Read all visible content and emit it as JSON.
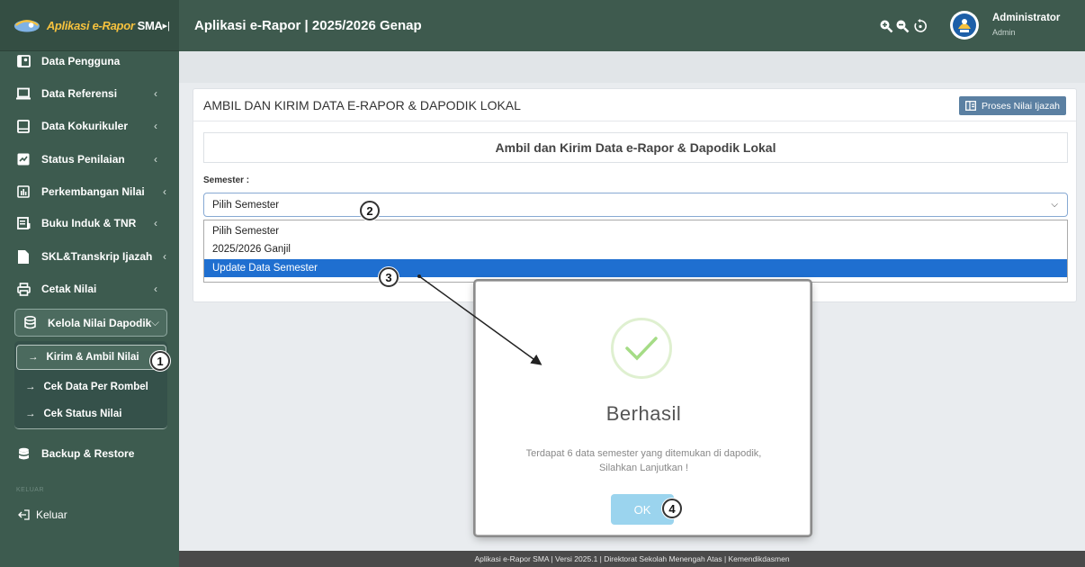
{
  "brand": {
    "name": "Aplikasi e-Rapor",
    "suffix": "SMA",
    "collapse_icon": "sidebar-collapse-icon"
  },
  "topbar": {
    "title": "Aplikasi e-Rapor | 2025/2026 Genap",
    "icons": [
      "zoom-in-icon",
      "zoom-out-icon",
      "refresh-icon"
    ],
    "user_name": "Administrator",
    "user_role": "Admin"
  },
  "sidebar": {
    "items": [
      {
        "label": "Data Pengguna",
        "icon": "user-card-icon",
        "caret": ""
      },
      {
        "label": "Data Referensi",
        "icon": "laptop-icon",
        "caret": "‹"
      },
      {
        "label": "Data Kokurikuler",
        "icon": "tablet-icon",
        "caret": "‹"
      },
      {
        "label": "Status Penilaian",
        "icon": "chart-line-icon",
        "caret": "‹"
      },
      {
        "label": "Perkembangan Nilai",
        "icon": "bar-chart-icon",
        "caret": "‹"
      },
      {
        "label": "Buku Induk & TNR",
        "icon": "book-icon",
        "caret": "‹"
      },
      {
        "label": "SKL&Transkrip Ijazah",
        "icon": "document-icon",
        "caret": "‹"
      },
      {
        "label": "Cetak Nilai",
        "icon": "printer-icon",
        "caret": "‹"
      },
      {
        "label": "Kelola Nilai Dapodik",
        "icon": "database-icon",
        "caret": "⌵"
      },
      {
        "label": "Backup & Restore",
        "icon": "database-icon",
        "caret": ""
      }
    ],
    "submenu": [
      {
        "label": "Kirim & Ambil Nilai",
        "active": true
      },
      {
        "label": "Cek Data Per Rombel",
        "active": false
      },
      {
        "label": "Cek Status Nilai",
        "active": false
      }
    ],
    "logout_header": "KELUAR",
    "logout_label": "Keluar"
  },
  "card": {
    "title": "AMBIL DAN KIRIM DATA E-RAPOR & DAPODIK LOKAL",
    "proses_button": "Proses Nilai Ijazah",
    "subtitle": "Ambil dan Kirim Data e-Rapor & Dapodik Lokal",
    "semester_label": "Semester :",
    "semester_selected": "Pilih Semester",
    "options": [
      "Pilih Semester",
      "2025/2026 Ganjil",
      "Update Data Semester"
    ],
    "highlighted_option": "Update Data Semester"
  },
  "dialog": {
    "title": "Berhasil",
    "line1": "Terdapat 6 data semester yang ditemukan di dapodik,",
    "line2": "Silahkan Lanjutkan !",
    "ok_label": "OK",
    "icon": "success-check-icon"
  },
  "steps": [
    "1",
    "2",
    "3",
    "4"
  ],
  "footer": "Aplikasi e-Rapor SMA | Versi 2025.1 | Direktorat Sekolah Menengah Atas | Kemendikdasmen",
  "colors": {
    "sidebar": "#3d5b4f",
    "topbar": "#3e5a4e",
    "selected_option": "#1f6fd0",
    "ok_button": "#9bd4ee",
    "proses_button": "#5b80a2"
  }
}
